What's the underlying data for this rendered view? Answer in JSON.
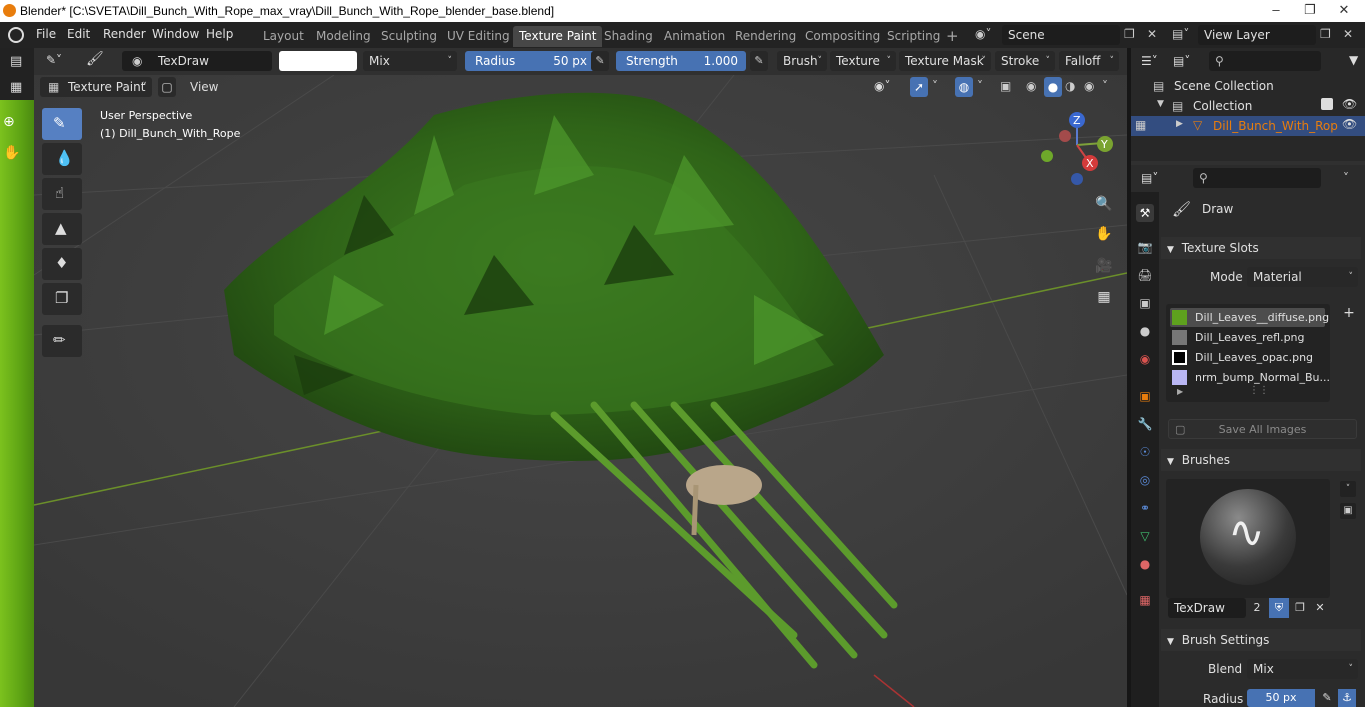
{
  "window": {
    "title": "Blender* [C:\\SVETA\\Dill_Bunch_With_Rope_max_vray\\Dill_Bunch_With_Rope_blender_base.blend]"
  },
  "menu": [
    "File",
    "Edit",
    "Render",
    "Window",
    "Help"
  ],
  "workspaces": [
    "Layout",
    "Modeling",
    "Sculpting",
    "UV Editing",
    "Texture Paint",
    "Shading",
    "Animation",
    "Rendering",
    "Compositing",
    "Scripting"
  ],
  "active_workspace": "Texture Paint",
  "scene": {
    "label": "Scene"
  },
  "view_layer": {
    "label": "View Layer"
  },
  "tool_header": {
    "brush_name": "TexDraw",
    "blend": "Mix",
    "radius_label": "Radius",
    "radius_value": "50 px",
    "strength_label": "Strength",
    "strength_value": "1.000",
    "menus": [
      "Brush",
      "Texture",
      "Texture Mask",
      "Stroke",
      "Falloff"
    ]
  },
  "viewport_header": {
    "mode": "Texture Paint",
    "view": "View"
  },
  "viewport": {
    "perspective": "User Perspective",
    "object": "(1) Dill_Bunch_With_Rope",
    "gizmo": {
      "z": "Z",
      "y": "Y",
      "x": "X"
    }
  },
  "outliner": {
    "scene_collection": "Scene Collection",
    "collection": "Collection",
    "object": "Dill_Bunch_With_Rop"
  },
  "properties": {
    "tool_name": "Draw",
    "texture_slots": {
      "header": "Texture Slots",
      "mode_label": "Mode",
      "mode_value": "Material",
      "slots": [
        "Dill_Leaves__diffuse.png",
        "Dill_Leaves_refl.png",
        "Dill_Leaves_opac.png",
        "nrm_bump_Normal_Bu..."
      ],
      "save_all": "Save All Images"
    },
    "brushes": {
      "header": "Brushes",
      "brush_name": "TexDraw",
      "users": "2"
    },
    "brush_settings": {
      "header": "Brush Settings",
      "blend_label": "Blend",
      "blend_value": "Mix",
      "radius_label": "Radius",
      "radius_value": "50 px"
    }
  },
  "colors": {
    "accent": "#4772b3",
    "active_tab": "#474747",
    "orange": "#e87d0d"
  }
}
